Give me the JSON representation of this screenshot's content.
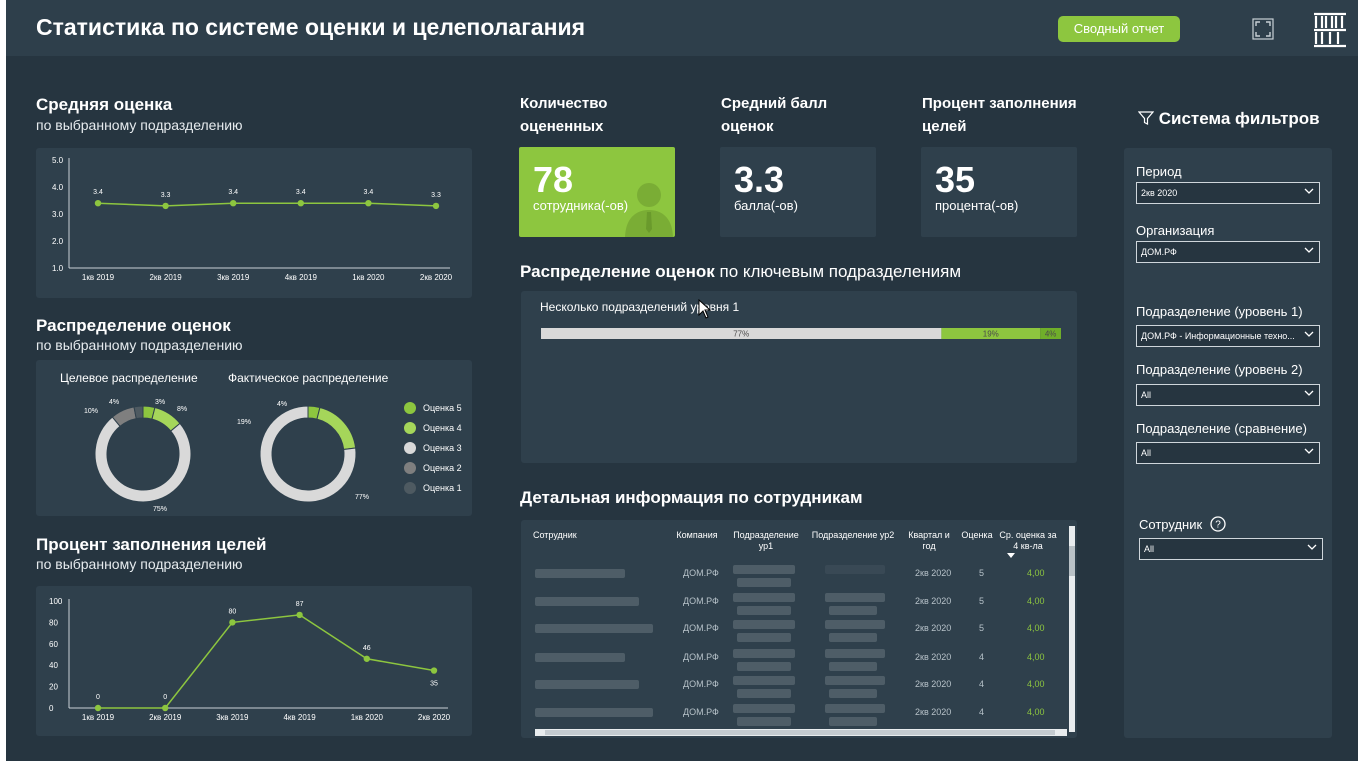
{
  "header": {
    "title": "Статистика по системе оценки и целеполагания",
    "summary_button": "Сводный отчет",
    "expand_icon": "expand-icon",
    "logo_text": "ДОМ РФ"
  },
  "avg_score": {
    "title": "Средняя оценка",
    "subtitle": "по выбранному подразделению",
    "chart_data": {
      "type": "line",
      "categories": [
        "1кв 2019",
        "2кв 2019",
        "3кв 2019",
        "4кв 2019",
        "1кв 2020",
        "2кв 2020"
      ],
      "series": [
        {
          "values": [
            3.4,
            3.3,
            3.4,
            3.4,
            3.4,
            3.3
          ]
        }
      ],
      "data_labels": [
        "3.4",
        "3.3",
        "3.4",
        "3.4",
        "3.4",
        "3.3"
      ],
      "yticks": [
        "5.0",
        "4.0",
        "3.0",
        "2.0",
        "1.0"
      ],
      "ylim": [
        1,
        5
      ],
      "color": "#8dc63f"
    }
  },
  "distribution": {
    "title": "Распределение оценок",
    "subtitle": "по выбранному подразделению",
    "target_label": "Целевое распределение",
    "actual_label": "Фактическое распределение",
    "chart_data": [
      {
        "type": "pie",
        "name": "Целевое распределение",
        "categories": [
          "Оценка 5",
          "Оценка 4",
          "Оценка 3",
          "Оценка 2",
          "Оценка 1"
        ],
        "values": [
          4,
          10,
          75,
          8,
          3
        ],
        "labels": {
          "Оценка 5": "4%",
          "Оценка 4": "10%",
          "Оценка 3": "75%",
          "Оценка 2": "8%",
          "Оценка 1": "3%"
        }
      },
      {
        "type": "pie",
        "name": "Фактическое распределение",
        "categories": [
          "Оценка 5",
          "Оценка 4",
          "Оценка 3"
        ],
        "values": [
          4,
          19,
          77
        ],
        "labels": {
          "Оценка 5": "4%",
          "Оценка 4": "19%",
          "Оценка 3": "77%"
        }
      }
    ],
    "legend": [
      {
        "label": "Оценка 5",
        "color": "#8dc63f"
      },
      {
        "label": "Оценка 4",
        "color": "#a5d65a"
      },
      {
        "label": "Оценка 3",
        "color": "#d9d9d9"
      },
      {
        "label": "Оценка 2",
        "color": "#7f7f7f"
      },
      {
        "label": "Оценка 1",
        "color": "#4e5a61"
      }
    ]
  },
  "goals": {
    "title": "Процент заполнения целей",
    "subtitle": "по выбранному подразделению",
    "chart_data": {
      "type": "line",
      "categories": [
        "1кв 2019",
        "2кв 2019",
        "3кв 2019",
        "4кв 2019",
        "1кв 2020",
        "2кв 2020"
      ],
      "series": [
        {
          "values": [
            0,
            0,
            80,
            87,
            46,
            35
          ]
        }
      ],
      "data_labels": [
        "0",
        "0",
        "80",
        "87",
        "46",
        "35"
      ],
      "yticks": [
        "100",
        "80",
        "60",
        "40",
        "20",
        "0"
      ],
      "ylim": [
        0,
        100
      ],
      "color": "#8dc63f"
    }
  },
  "kpis": [
    {
      "label": "Количество оцененных",
      "value": "78",
      "unit": "сотрудника(-ов)"
    },
    {
      "label": "Средний балл оценок",
      "value": "3.3",
      "unit": "балла(-ов)"
    },
    {
      "label": "Процент заполнения целей",
      "value": "35",
      "unit": "процента(-ов)"
    }
  ],
  "key_units": {
    "title_bold": "Распределение оценок",
    "title_light": " по ключевым подразделениям",
    "row_label": "Несколько подразделений уровня 1",
    "chart_data": {
      "type": "bar",
      "stacked": true,
      "categories": [
        "Несколько подразделений уровня 1"
      ],
      "series": [
        {
          "name": "Оценка 3",
          "values": [
            77
          ],
          "label": "77%",
          "color": "#d9d9d9"
        },
        {
          "name": "Оценка 4",
          "values": [
            19
          ],
          "label": "19%",
          "color": "#8dc63f"
        },
        {
          "name": "Оценка 5",
          "values": [
            4
          ],
          "label": "4%",
          "color": "#6fae2a"
        }
      ]
    }
  },
  "details": {
    "title": "Детальная информация по сотрудникам",
    "columns": [
      "Сотрудник",
      "Компания",
      "Подразделение ур1",
      "Подразделение ур2",
      "Квартал и год",
      "Оценка",
      "Ср. оценка за 4 кв-ла"
    ],
    "rows": [
      {
        "company": "ДОМ.РФ",
        "quarter": "2кв 2020",
        "score": "5",
        "avg": "4,00"
      },
      {
        "company": "ДОМ.РФ",
        "quarter": "2кв 2020",
        "score": "5",
        "avg": "4,00"
      },
      {
        "company": "ДОМ.РФ",
        "quarter": "2кв 2020",
        "score": "5",
        "avg": "4,00"
      },
      {
        "company": "ДОМ.РФ",
        "quarter": "2кв 2020",
        "score": "4",
        "avg": "4,00"
      },
      {
        "company": "ДОМ.РФ",
        "quarter": "2кв 2020",
        "score": "4",
        "avg": "4,00"
      },
      {
        "company": "ДОМ.РФ",
        "quarter": "2кв 2020",
        "score": "4",
        "avg": "4,00"
      }
    ]
  },
  "filters": {
    "title": "Система фильтров",
    "items": [
      {
        "label": "Период",
        "value": "2кв 2020"
      },
      {
        "label": "Организация",
        "value": "ДОМ.РФ"
      },
      {
        "label": "Подразделение (уровень 1)",
        "value": "ДОМ.РФ - Информационные техно..."
      },
      {
        "label": "Подразделение (уровень 2)",
        "value": "All"
      },
      {
        "label": "Подразделение (сравнение)",
        "value": "All"
      },
      {
        "label": "Сотрудник",
        "value": "All"
      }
    ]
  }
}
